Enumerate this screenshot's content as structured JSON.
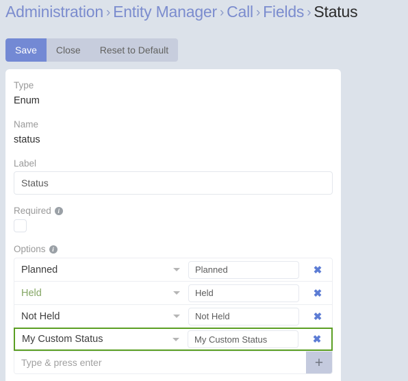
{
  "breadcrumb": {
    "separator": "›",
    "items": [
      {
        "label": "Administration",
        "current": false
      },
      {
        "label": "Entity Manager",
        "current": false
      },
      {
        "label": "Call",
        "current": false
      },
      {
        "label": "Fields",
        "current": false
      },
      {
        "label": "Status",
        "current": true
      }
    ]
  },
  "toolbar": {
    "save_label": "Save",
    "close_label": "Close",
    "reset_label": "Reset to Default"
  },
  "form": {
    "type": {
      "label": "Type",
      "value": "Enum"
    },
    "name": {
      "label": "Name",
      "value": "status"
    },
    "label": {
      "label": "Label",
      "value": "Status",
      "placeholder": ""
    },
    "required": {
      "label": "Required",
      "info": "i",
      "checked": false
    },
    "options": {
      "label": "Options",
      "info": "i",
      "rows": [
        {
          "name": "Planned",
          "value": "Planned",
          "accent": false,
          "selected": false,
          "remove_icon": "✖"
        },
        {
          "name": "Held",
          "value": "Held",
          "accent": true,
          "selected": false,
          "remove_icon": "✖"
        },
        {
          "name": "Not Held",
          "value": "Not Held",
          "accent": false,
          "selected": false,
          "remove_icon": "✖"
        },
        {
          "name": "My Custom Status",
          "value": "My Custom Status",
          "accent": false,
          "selected": true,
          "remove_icon": "✖"
        }
      ],
      "add_placeholder": "Type & press enter",
      "add_value": "",
      "add_icon": "+"
    }
  },
  "colors": {
    "page_background": "#dce2ea",
    "accent_primary": "#7389d4",
    "selected_border": "#5a9e22",
    "link": "#7b8cce",
    "remove_icon": "#5c7cd4",
    "option_accent_text": "#84a664"
  }
}
